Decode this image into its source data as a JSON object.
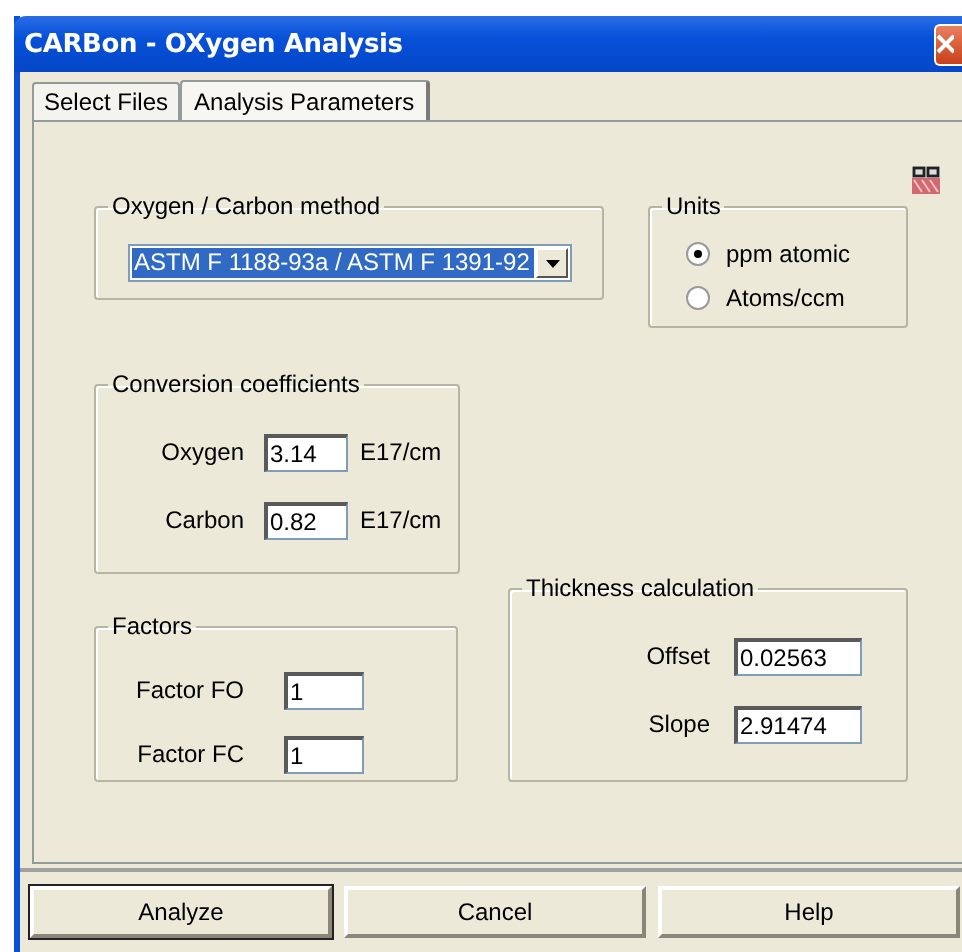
{
  "window": {
    "title": "CARBon - OXygen Analysis"
  },
  "tabs": [
    {
      "label": "Select Files",
      "selected": false
    },
    {
      "label": "Analysis Parameters",
      "selected": true
    }
  ],
  "method_group": {
    "title": "Oxygen / Carbon method",
    "value": "ASTM F 1188-93a / ASTM F 1391-92"
  },
  "units": {
    "title": "Units",
    "options": [
      {
        "label": "ppm atomic",
        "selected": true
      },
      {
        "label": "Atoms/ccm",
        "selected": false
      }
    ]
  },
  "conversion": {
    "title": "Conversion coefficients",
    "rows": [
      {
        "label": "Oxygen",
        "value": "3.14",
        "unit": "E17/cm"
      },
      {
        "label": "Carbon",
        "value": "0.82",
        "unit": "E17/cm"
      }
    ]
  },
  "factors": {
    "title": "Factors",
    "rows": [
      {
        "label": "Factor FO",
        "value": "1"
      },
      {
        "label": "Factor FC",
        "value": "1"
      }
    ]
  },
  "thickness": {
    "title": "Thickness calculation",
    "rows": [
      {
        "label": "Offset",
        "value": "0.02563"
      },
      {
        "label": "Slope",
        "value": "2.91474"
      }
    ]
  },
  "buttons": [
    {
      "label": "Analyze",
      "default": true
    },
    {
      "label": "Cancel",
      "default": false
    },
    {
      "label": "Help",
      "default": false
    }
  ]
}
